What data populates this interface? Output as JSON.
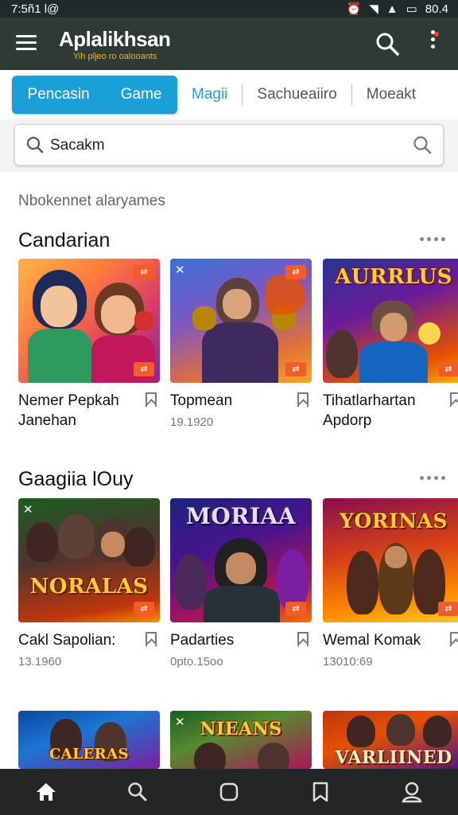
{
  "status_bar": {
    "time": "7:5ñ1 l@",
    "battery": "80.4"
  },
  "app_bar": {
    "title": "Aplalikhsan",
    "subtitle": "Yih pljeo ro oalooants"
  },
  "tabs": [
    {
      "label_a": "Pencasin",
      "label_b": "Game",
      "active": true
    },
    {
      "label": "Magii"
    },
    {
      "label": "Sachueaiiro"
    },
    {
      "label": "Moeakt"
    }
  ],
  "search": {
    "placeholder": "Sacakm"
  },
  "caption": "Nbokennet alaryames",
  "sections": [
    {
      "title": "Candarian",
      "cards": [
        {
          "title": "Nemer Pepkah Janehan",
          "subtitle": ""
        },
        {
          "title": "Topmean",
          "subtitle": "19.1920"
        },
        {
          "title": "Tihatlarhartan Apdorp",
          "subtitle": "",
          "art_title": "AURRLUS"
        }
      ]
    },
    {
      "title": "Gaagiia lOuy",
      "cards": [
        {
          "title": "Cakl Sapolian:",
          "subtitle": "13.1960",
          "art_title": "NORALAS"
        },
        {
          "title": "Padarties",
          "subtitle": "0pto.15oo",
          "art_title": "MORIAA"
        },
        {
          "title": "Wemal Komak",
          "subtitle": "13010:69",
          "art_title": "YORINAS"
        }
      ]
    },
    {
      "cards": [
        {
          "art_title": "CALERAS"
        },
        {
          "art_title": "NIEANS"
        },
        {
          "art_title": "VARLIINED"
        }
      ]
    }
  ],
  "colors": {
    "app_bar": "#2d3a36",
    "accent": "#1aa0d8",
    "badge": "#f25c26",
    "nav_bar": "#232527"
  }
}
